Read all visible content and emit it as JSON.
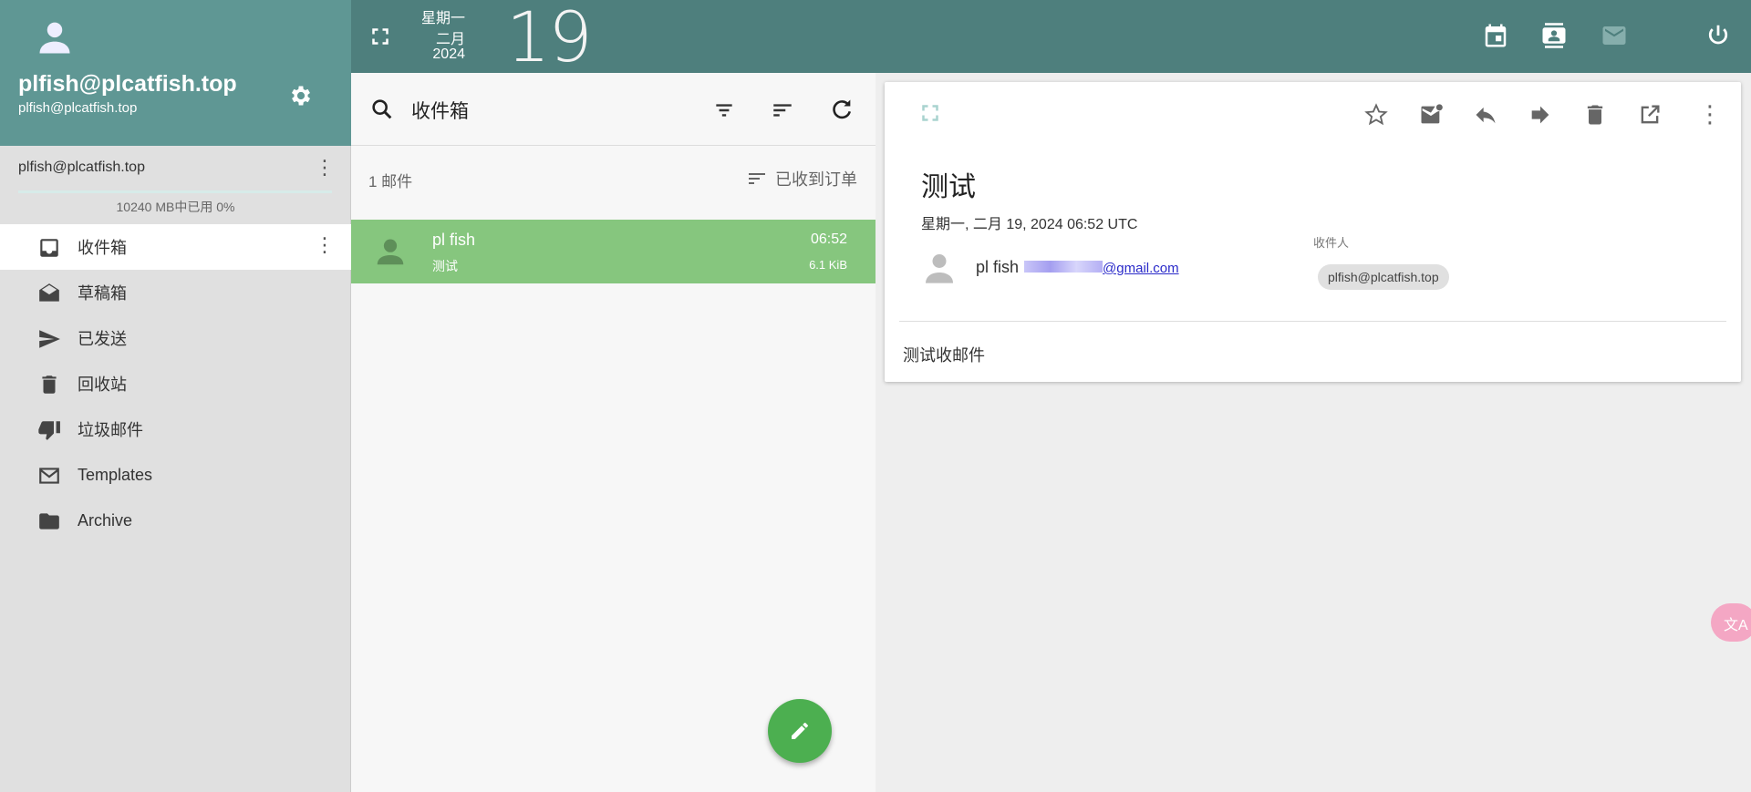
{
  "sidebar": {
    "display_name": "plfish@plcatfish.top",
    "email": "plfish@plcatfish.top",
    "account": "plfish@plcatfish.top",
    "quota_text": "10240 MB中已用 0%",
    "quota_used_percent": 0,
    "folders": [
      {
        "label": "收件箱",
        "icon": "inbox-icon",
        "active": true
      },
      {
        "label": "草稿箱",
        "icon": "drafts-icon"
      },
      {
        "label": "已发送",
        "icon": "send-icon"
      },
      {
        "label": "回收站",
        "icon": "trash-icon"
      },
      {
        "label": "垃圾邮件",
        "icon": "thumb-down-icon"
      },
      {
        "label": "Templates",
        "icon": "mail-outline-icon"
      },
      {
        "label": "Archive",
        "icon": "folder-icon"
      }
    ]
  },
  "topbar": {
    "weekday": "星期一",
    "month": "二月",
    "year": "2024",
    "day": "19"
  },
  "list": {
    "search_value": "收件箱",
    "count": "1 邮件",
    "sort_label": "已收到订单",
    "messages": [
      {
        "from": "pl fish",
        "subject": "测试",
        "time": "06:52",
        "size": "6.1 KiB"
      }
    ]
  },
  "message": {
    "subject": "测试",
    "date": "星期一, 二月 19, 2024 06:52 UTC",
    "from_name": "pl fish",
    "from_email": "@gmail.com",
    "to_label": "收件人",
    "to": "plfish@plcatfish.top",
    "body": "测试收邮件"
  },
  "colors": {
    "header": "#5f9794",
    "topbar": "#4e7f7d",
    "selected": "#86c67e",
    "fab": "#4caf50"
  }
}
